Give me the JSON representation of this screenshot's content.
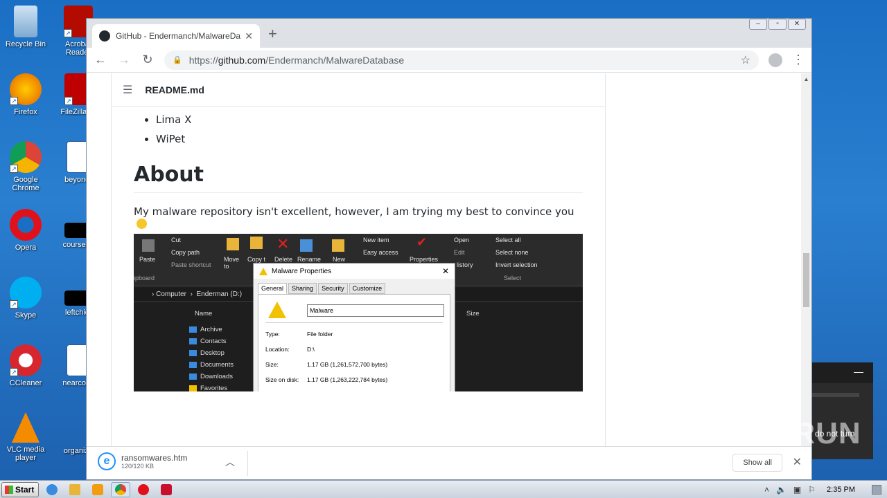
{
  "desktop": {
    "icons": [
      {
        "label": "Recycle Bin"
      },
      {
        "label": "Acrobat Reader"
      },
      {
        "label": "Firefox"
      },
      {
        "label": "FileZilla Cl"
      },
      {
        "label": "Google Chrome"
      },
      {
        "label": "beyondr"
      },
      {
        "label": "Opera"
      },
      {
        "label": "courseas"
      },
      {
        "label": "Skype"
      },
      {
        "label": "leftchief"
      },
      {
        "label": "CCleaner"
      },
      {
        "label": "nearcopy"
      },
      {
        "label": "VLC media player"
      },
      {
        "label": "organiza"
      }
    ]
  },
  "browser": {
    "tab_title": "GitHub - Endermanch/MalwareDatab",
    "url_scheme": "https://",
    "url_host": "github.com",
    "url_path": "/Endermanch/MalwareDatabase"
  },
  "readme": {
    "filename": "README.md",
    "list_items": [
      "Lima X",
      "WiPet"
    ],
    "heading": "About",
    "paragraph": "My malware repository isn't excellent, however, I am trying my best to convince you"
  },
  "embedded_screenshot": {
    "ribbon": {
      "cut": "Cut",
      "copy_path": "Copy path",
      "paste": "Paste",
      "paste_shortcut": "Paste shortcut",
      "clipboard": "ipboard",
      "move_to": "Move to",
      "copy_to": "Copy t",
      "delete": "Delete",
      "rename": "Rename",
      "new": "New",
      "new_item": "New item",
      "easy_access": "Easy access",
      "properties": "Properties",
      "open": "Open",
      "edit": "Edit",
      "history": "listory",
      "select_all": "Select all",
      "select_none": "Select none",
      "invert_selection": "Invert selection",
      "select_group": "Select"
    },
    "address": {
      "computer": "Computer",
      "drive": "Enderman (D:)"
    },
    "columns": {
      "name": "Name",
      "size": "Size"
    },
    "files": [
      "Archive",
      "Contacts",
      "Desktop",
      "Documents",
      "Downloads",
      "Favorites"
    ],
    "dialog": {
      "title": "Malware Properties",
      "tabs": [
        "General",
        "Sharing",
        "Security",
        "Customize"
      ],
      "name_value": "Malware",
      "type_label": "Type:",
      "type_value": "File folder",
      "location_label": "Location:",
      "location_value": "D:\\",
      "size_label": "Size:",
      "size_value": "1.17 GB (1,261,572,700 bytes)",
      "size_on_disk_label": "Size on disk:",
      "size_on_disk_value": "1.17 GB (1,263,222,784 bytes)"
    }
  },
  "download_bar": {
    "file_name": "ransomwares.htm",
    "file_size": "120/120 KB",
    "show_all": "Show all"
  },
  "notification": {
    "text": "do not turn"
  },
  "watermark": "ANY RUN",
  "taskbar": {
    "start": "Start",
    "time": "2:35 PM"
  }
}
